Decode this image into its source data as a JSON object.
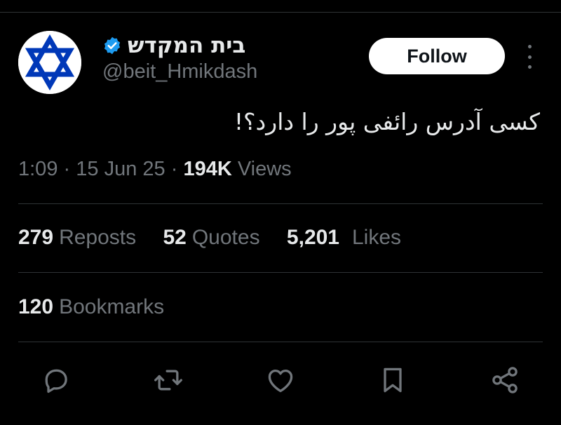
{
  "author": {
    "display_name": "בית המקדש",
    "handle": "@beit_Hmikdash",
    "verified": true,
    "avatar": "star-of-david-flag-icon"
  },
  "follow_button": {
    "label": "Follow"
  },
  "tweet": {
    "text": "کسی آدرس رائفی پور را دارد؟!",
    "time": "1:09",
    "date": "15 Jun 25",
    "separator": "·",
    "views_count": "194K",
    "views_label": "Views"
  },
  "stats": {
    "reposts": {
      "count": "279",
      "label": "Reposts"
    },
    "quotes": {
      "count": "52",
      "label": "Quotes"
    },
    "likes": {
      "count": "5,201",
      "label": "Likes"
    },
    "bookmarks": {
      "count": "120",
      "label": "Bookmarks"
    }
  },
  "actions": [
    "reply-icon",
    "repost-icon",
    "like-icon",
    "bookmark-icon",
    "share-icon"
  ],
  "colors": {
    "background": "#000000",
    "text": "#e7e9ea",
    "secondary": "#71767b",
    "divider": "#2f3336",
    "verified": "#1d9bf0",
    "star": "#0038b8"
  }
}
